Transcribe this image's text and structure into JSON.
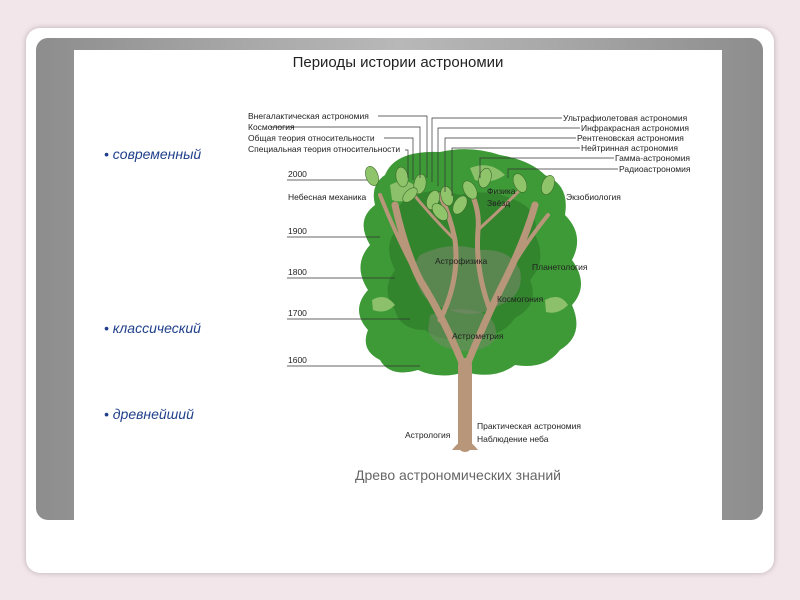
{
  "slide": {
    "title": "Периоды истории астрономии",
    "periods": [
      "• современный",
      "• классический",
      "• древнейший"
    ],
    "caption": "Древо астрономических знаний"
  },
  "tree": {
    "left_labels": [
      "Внегалактическая астрономия",
      "Космология",
      "Общая теория относительности",
      "Специальная теория относительности"
    ],
    "right_labels": [
      "Ультрафиолетовая астрономия",
      "Инфракрасная астрономия",
      "Рентгеновская астрономия",
      "Нейтринная астрономия",
      "Гамма-астрономия",
      "Радиоастрономия"
    ],
    "years": [
      "2000",
      "1900",
      "1800",
      "1700",
      "1600"
    ],
    "branches": {
      "celestial_mechanics": "Небесная механика",
      "physics": "Физика",
      "stars": "Звёзд",
      "exobiology": "Экзобиология",
      "astrophysics": "Астрофизика",
      "planetology": "Планетология",
      "cosmogony": "Космогония",
      "astrometry": "Астрометрия"
    },
    "roots": {
      "astrology": "Астрология",
      "practical": "Практическая астрономия",
      "observation": "Наблюдение неба"
    }
  }
}
